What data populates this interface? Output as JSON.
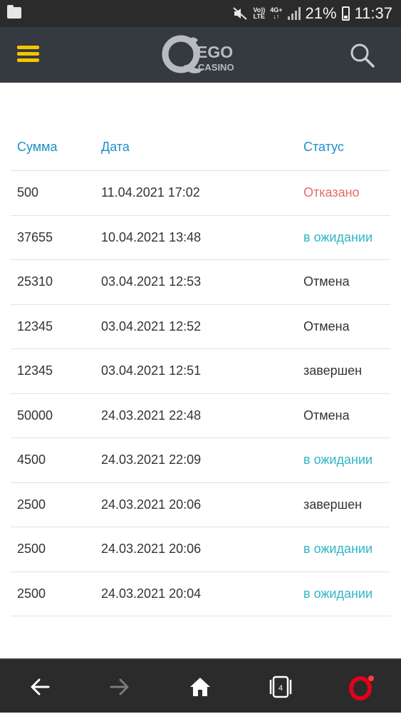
{
  "status_bar": {
    "network_label_top": "Vo))",
    "network_label_bottom": "LTE",
    "data_label_top": "4G+",
    "data_label_bottom": "↓↑",
    "battery": "21%",
    "time": "11:37"
  },
  "header": {
    "logo_text_ego": "EGO",
    "logo_text_casino": "CASINO",
    "colors": {
      "background": "#343a40",
      "menu": "#f5c400",
      "logo": "#b8bcc2"
    }
  },
  "table": {
    "columns": [
      "Сумма",
      "Дата",
      "Статус"
    ],
    "rows": [
      {
        "amount": "500",
        "date": "11.04.2021 17:02",
        "status": "Отказано",
        "status_type": "rejected"
      },
      {
        "amount": "37655",
        "date": "10.04.2021 13:48",
        "status": "в ожидании",
        "status_type": "pending"
      },
      {
        "amount": "25310",
        "date": "03.04.2021 12:53",
        "status": "Отмена",
        "status_type": "default"
      },
      {
        "amount": "12345",
        "date": "03.04.2021 12:52",
        "status": "Отмена",
        "status_type": "default"
      },
      {
        "amount": "12345",
        "date": "03.04.2021 12:51",
        "status": "завершен",
        "status_type": "default"
      },
      {
        "amount": "50000",
        "date": "24.03.2021 22:48",
        "status": "Отмена",
        "status_type": "default"
      },
      {
        "amount": "4500",
        "date": "24.03.2021 22:09",
        "status": "в ожидании",
        "status_type": "pending"
      },
      {
        "amount": "2500",
        "date": "24.03.2021 20:06",
        "status": "завершен",
        "status_type": "default"
      },
      {
        "amount": "2500",
        "date": "24.03.2021 20:06",
        "status": "в ожидании",
        "status_type": "pending"
      },
      {
        "amount": "2500",
        "date": "24.03.2021 20:04",
        "status": "в ожидании",
        "status_type": "pending"
      }
    ]
  },
  "browser_nav": {
    "tabs_count": "4",
    "icons": [
      "back-arrow-icon",
      "forward-arrow-icon",
      "home-icon",
      "tabs-icon",
      "opera-icon"
    ]
  }
}
